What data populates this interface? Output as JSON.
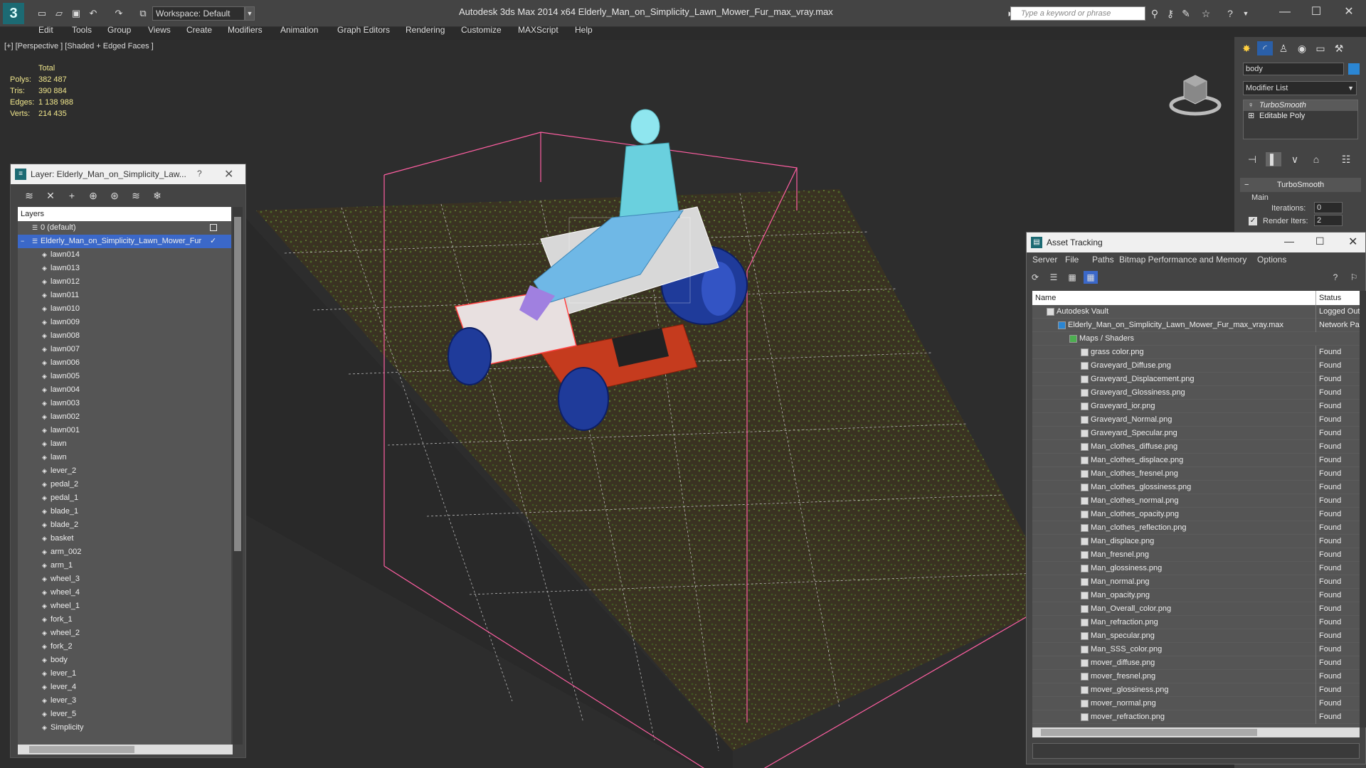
{
  "app": {
    "title": "Autodesk 3ds Max  2014 x64     Elderly_Man_on_Simplicity_Lawn_Mower_Fur_max_vray.max",
    "workspace": "Workspace: Default",
    "search_placeholder": "Type a keyword or phrase"
  },
  "menu": [
    "Edit",
    "Tools",
    "Group",
    "Views",
    "Create",
    "Modifiers",
    "Animation",
    "Graph Editors",
    "Rendering",
    "Customize",
    "MAXScript",
    "Help"
  ],
  "viewport": {
    "label": "[+] [Perspective ] [Shaded + Edged Faces ]",
    "stats": {
      "total_label": "Total",
      "polys_label": "Polys:",
      "polys": "382 487",
      "tris_label": "Tris:",
      "tris": "390 884",
      "edges_label": "Edges:",
      "edges": "1 138 988",
      "verts_label": "Verts:",
      "verts": "214 435"
    }
  },
  "layer_panel": {
    "title": "Layer: Elderly_Man_on_Simplicity_Law...",
    "help": "?",
    "header": "Layers",
    "default_layer": "0 (default)",
    "selected_layer": "Elderly_Man_on_Simplicity_Lawn_Mower_Fur",
    "items": [
      "lawn014",
      "lawn013",
      "lawn012",
      "lawn011",
      "lawn010",
      "lawn009",
      "lawn008",
      "lawn007",
      "lawn006",
      "lawn005",
      "lawn004",
      "lawn003",
      "lawn002",
      "lawn001",
      "lawn",
      "lawn",
      "lever_2",
      "pedal_2",
      "pedal_1",
      "blade_1",
      "blade_2",
      "basket",
      "arm_002",
      "arm_1",
      "wheel_3",
      "wheel_4",
      "wheel_1",
      "fork_1",
      "wheel_2",
      "fork_2",
      "body",
      "lever_1",
      "lever_4",
      "lever_3",
      "lever_5",
      "Simplicity"
    ]
  },
  "command_panel": {
    "object_name": "body",
    "modifier_list": "Modifier List",
    "stack": [
      "TurboSmooth",
      "Editable Poly"
    ],
    "rollout_title": "TurboSmooth",
    "main_label": "Main",
    "iterations_label": "Iterations:",
    "iterations": "0",
    "render_iters_label": "Render Iters:",
    "render_iters": "2",
    "object_color": "#2b86d3"
  },
  "asset_tracking": {
    "title": "Asset Tracking",
    "menu": [
      "Server",
      "File",
      "Paths",
      "Bitmap Performance and Memory",
      "Options"
    ],
    "columns": {
      "name": "Name",
      "status": "Status"
    },
    "vault": {
      "name": "Autodesk Vault",
      "status": "Logged Out"
    },
    "file": {
      "name": "Elderly_Man_on_Simplicity_Lawn_Mower_Fur_max_vray.max",
      "status": "Network Path"
    },
    "group": "Maps / Shaders",
    "maps": [
      {
        "name": "grass color.png",
        "status": "Found"
      },
      {
        "name": "Graveyard_Diffuse.png",
        "status": "Found"
      },
      {
        "name": "Graveyard_Displacement.png",
        "status": "Found"
      },
      {
        "name": "Graveyard_Glossiness.png",
        "status": "Found"
      },
      {
        "name": "Graveyard_ior.png",
        "status": "Found"
      },
      {
        "name": "Graveyard_Normal.png",
        "status": "Found"
      },
      {
        "name": "Graveyard_Specular.png",
        "status": "Found"
      },
      {
        "name": "Man_clothes_diffuse.png",
        "status": "Found"
      },
      {
        "name": "Man_clothes_displace.png",
        "status": "Found"
      },
      {
        "name": "Man_clothes_fresnel.png",
        "status": "Found"
      },
      {
        "name": "Man_clothes_glossiness.png",
        "status": "Found"
      },
      {
        "name": "Man_clothes_normal.png",
        "status": "Found"
      },
      {
        "name": "Man_clothes_opacity.png",
        "status": "Found"
      },
      {
        "name": "Man_clothes_reflection.png",
        "status": "Found"
      },
      {
        "name": "Man_displace.png",
        "status": "Found"
      },
      {
        "name": "Man_fresnel.png",
        "status": "Found"
      },
      {
        "name": "Man_glossiness.png",
        "status": "Found"
      },
      {
        "name": "Man_normal.png",
        "status": "Found"
      },
      {
        "name": "Man_opacity.png",
        "status": "Found"
      },
      {
        "name": "Man_Overall_color.png",
        "status": "Found"
      },
      {
        "name": "Man_refraction.png",
        "status": "Found"
      },
      {
        "name": "Man_specular.png",
        "status": "Found"
      },
      {
        "name": "Man_SSS_color.png",
        "status": "Found"
      },
      {
        "name": "mover_diffuse.png",
        "status": "Found"
      },
      {
        "name": "mover_fresnel.png",
        "status": "Found"
      },
      {
        "name": "mover_glossiness.png",
        "status": "Found"
      },
      {
        "name": "mover_normal.png",
        "status": "Found"
      },
      {
        "name": "mover_refraction.png",
        "status": "Found"
      }
    ]
  }
}
